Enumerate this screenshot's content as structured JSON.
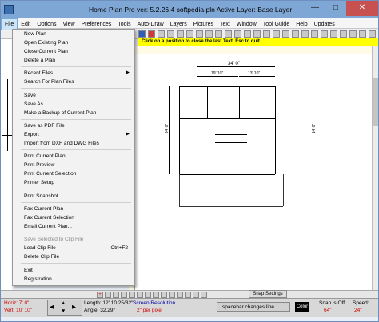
{
  "window": {
    "title": "Home Plan Pro ver: 5.2.26.4   softpedia.pln     Active Layer: Base Layer",
    "minimize": "—",
    "maximize": "□",
    "close": "✕"
  },
  "menubar": [
    "File",
    "Edit",
    "Options",
    "View",
    "Preferences",
    "Tools",
    "Auto-Draw",
    "Layers",
    "Pictures",
    "Text",
    "Window",
    "Tool Guide",
    "Help",
    "Updates"
  ],
  "toolbar": {
    "hint": "Click on a position to close the last Text. Esc to quit."
  },
  "file_menu": {
    "items": [
      {
        "label": "New Plan",
        "shortcut": "",
        "submenu": false,
        "disabled": false
      },
      {
        "label": "Open Existing Plan",
        "shortcut": "",
        "submenu": false,
        "disabled": false
      },
      {
        "label": "Close Current Plan",
        "shortcut": "",
        "submenu": false,
        "disabled": false
      },
      {
        "label": "Delete a Plan",
        "shortcut": "",
        "submenu": false,
        "disabled": false
      },
      {
        "label": "Recent Files...",
        "shortcut": "",
        "submenu": true,
        "disabled": false
      },
      {
        "label": "Search For Plan Files",
        "shortcut": "",
        "submenu": false,
        "disabled": false
      },
      {
        "label": "Save",
        "shortcut": "",
        "submenu": false,
        "disabled": false
      },
      {
        "label": "Save As",
        "shortcut": "",
        "submenu": false,
        "disabled": false
      },
      {
        "label": "Make a Backup of Current Plan",
        "shortcut": "",
        "submenu": false,
        "disabled": false
      },
      {
        "label": "Save as PDF File",
        "shortcut": "",
        "submenu": false,
        "disabled": false
      },
      {
        "label": "Export",
        "shortcut": "",
        "submenu": true,
        "disabled": false
      },
      {
        "label": "Import from DXF and DWG Files",
        "shortcut": "",
        "submenu": false,
        "disabled": false
      },
      {
        "label": "Print Current Plan",
        "shortcut": "",
        "submenu": false,
        "disabled": false
      },
      {
        "label": "Print Preview",
        "shortcut": "",
        "submenu": false,
        "disabled": false
      },
      {
        "label": "Print Current Selection",
        "shortcut": "",
        "submenu": false,
        "disabled": false
      },
      {
        "label": "Printer Setup",
        "shortcut": "",
        "submenu": false,
        "disabled": false
      },
      {
        "label": "Print Snapshot",
        "shortcut": "",
        "submenu": false,
        "disabled": false
      },
      {
        "label": "Fax Current Plan",
        "shortcut": "",
        "submenu": false,
        "disabled": false
      },
      {
        "label": "Fax Current Selection",
        "shortcut": "",
        "submenu": false,
        "disabled": false
      },
      {
        "label": "Email Current Plan...",
        "shortcut": "",
        "submenu": false,
        "disabled": false
      },
      {
        "label": "Save Selected to Clip File",
        "shortcut": "",
        "submenu": false,
        "disabled": true
      },
      {
        "label": "Load Clip File",
        "shortcut": "Ctrl+F2",
        "submenu": false,
        "disabled": false
      },
      {
        "label": "Delete Clip File",
        "shortcut": "",
        "submenu": false,
        "disabled": false
      },
      {
        "label": "Exit",
        "shortcut": "",
        "submenu": false,
        "disabled": false
      },
      {
        "label": "Registration",
        "shortcut": "",
        "submenu": false,
        "disabled": false
      }
    ]
  },
  "plan": {
    "dim_top": "34' 0\"",
    "dim_a": "19' 10\"",
    "dim_b": "13' 10\"",
    "dim_side": "34' 0\"",
    "dim_side2": "14' 0\""
  },
  "bottom": {
    "snap_settings": "Snap Settings"
  },
  "status": {
    "horiz": "Horiz: 7' 0\"",
    "vert": "Vert: 10' 10\"",
    "length": "Length: 12' 10 25/32\"",
    "angle": "Angle: 32.29°",
    "screen_res_label": "Screen Resolution",
    "screen_res_value": "2\" per pixel",
    "spacebar": "spacebar changes line",
    "color": "Color",
    "snap_label": "Snap is Off",
    "snap_value": "64\"",
    "speed_label": "Speed:",
    "speed_value": "24\""
  }
}
